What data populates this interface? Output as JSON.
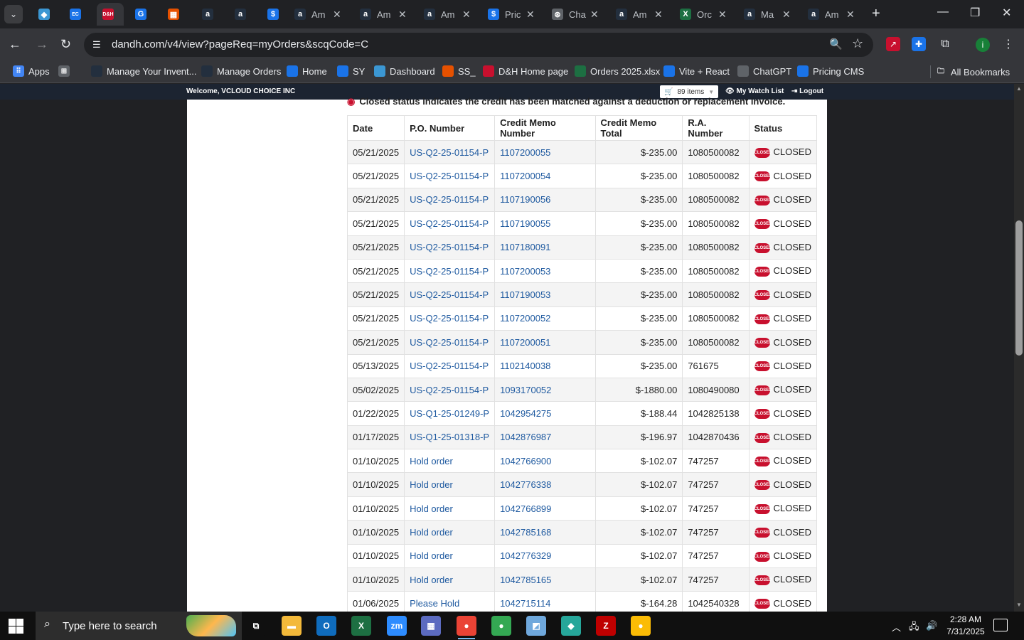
{
  "browser": {
    "tabs": [
      {
        "icon": "diamond-icon",
        "title": "",
        "color": "#3b97d3",
        "glyph": "◆"
      },
      {
        "icon": "ec-icon",
        "title": "",
        "color": "#1a73e8",
        "glyph": "EC"
      },
      {
        "icon": "dh-icon",
        "title": "",
        "color": "#c8102e",
        "glyph": "D&H",
        "active": true
      },
      {
        "icon": "g-icon",
        "title": "",
        "color": "#1a73e8",
        "glyph": "G"
      },
      {
        "icon": "box-icon",
        "title": "",
        "color": "#e65100",
        "glyph": "▦"
      },
      {
        "icon": "amazon-icon",
        "title": "",
        "color": "#232f3e",
        "glyph": "a"
      },
      {
        "icon": "amazon-icon",
        "title": "",
        "color": "#232f3e",
        "glyph": "a"
      },
      {
        "icon": "dollar-icon",
        "title": "",
        "color": "#1a73e8",
        "glyph": "$"
      },
      {
        "icon": "amazon-icon",
        "title": "Am",
        "color": "#232f3e",
        "glyph": "a"
      },
      {
        "icon": "amazon-icon",
        "title": "Am",
        "color": "#232f3e",
        "glyph": "a"
      },
      {
        "icon": "amazon-icon",
        "title": "Am",
        "color": "#232f3e",
        "glyph": "a"
      },
      {
        "icon": "dollar-icon",
        "title": "Pric",
        "color": "#1a73e8",
        "glyph": "$"
      },
      {
        "icon": "chatgpt-icon",
        "title": "Cha",
        "color": "#5f6368",
        "glyph": "⊛"
      },
      {
        "icon": "amazon-icon",
        "title": "Am",
        "color": "#232f3e",
        "glyph": "a"
      },
      {
        "icon": "excel-icon",
        "title": "Orc",
        "color": "#1d6f42",
        "glyph": "X"
      },
      {
        "icon": "amazon-icon",
        "title": "Ma",
        "color": "#232f3e",
        "glyph": "a"
      },
      {
        "icon": "amazon-icon",
        "title": "Am",
        "color": "#232f3e",
        "glyph": "a"
      }
    ],
    "url": "dandh.com/v4/view?pageReq=myOrders&scqCode=C",
    "profile_initial": "i",
    "bookmarks": [
      {
        "label": "Apps",
        "icon": "apps-grid-icon",
        "color": "#4285f4"
      },
      {
        "label": "",
        "icon": "tab-groups-icon",
        "color": "#5f6368"
      },
      {
        "label": "Manage Your Invent...",
        "icon": "amazon-icon",
        "color": "#232f3e"
      },
      {
        "label": "Manage Orders",
        "icon": "amazon-icon",
        "color": "#232f3e"
      },
      {
        "label": "Home",
        "icon": "g-icon",
        "color": "#1a73e8"
      },
      {
        "label": "SY",
        "icon": "ec-icon",
        "color": "#1a73e8"
      },
      {
        "label": "Dashboard",
        "icon": "diamond-icon",
        "color": "#3b97d3"
      },
      {
        "label": "SS_",
        "icon": "box-icon",
        "color": "#e65100"
      },
      {
        "label": "D&H Home page",
        "icon": "dh-icon",
        "color": "#c8102e"
      },
      {
        "label": "Orders 2025.xlsx",
        "icon": "excel-icon",
        "color": "#1d6f42"
      },
      {
        "label": "Vite + React",
        "icon": "dollar-icon",
        "color": "#1a73e8"
      },
      {
        "label": "ChatGPT",
        "icon": "chatgpt-icon",
        "color": "#5f6368"
      },
      {
        "label": "Pricing CMS",
        "icon": "dollar-icon",
        "color": "#1a73e8"
      }
    ],
    "all_bookmarks": "All Bookmarks"
  },
  "site": {
    "welcome": "Welcome, VCLOUD CHOICE INC",
    "cart_items": "89 items",
    "watch_list": "My Watch List",
    "logout": "Logout",
    "note": "Closed status indicates the credit has been matched against a deduction or replacement invoice."
  },
  "table": {
    "headers": [
      "Date",
      "P.O. Number",
      "Credit Memo Number",
      "Credit Memo Total",
      "R.A. Number",
      "Status"
    ],
    "status_badge_text": "CLOSED",
    "rows": [
      {
        "date": "05/21/2025",
        "po": "US-Q2-25-01154-P",
        "memo": "1107200055",
        "total": "$-235.00",
        "ra": "1080500082",
        "status": "CLOSED"
      },
      {
        "date": "05/21/2025",
        "po": "US-Q2-25-01154-P",
        "memo": "1107200054",
        "total": "$-235.00",
        "ra": "1080500082",
        "status": "CLOSED"
      },
      {
        "date": "05/21/2025",
        "po": "US-Q2-25-01154-P",
        "memo": "1107190056",
        "total": "$-235.00",
        "ra": "1080500082",
        "status": "CLOSED"
      },
      {
        "date": "05/21/2025",
        "po": "US-Q2-25-01154-P",
        "memo": "1107190055",
        "total": "$-235.00",
        "ra": "1080500082",
        "status": "CLOSED"
      },
      {
        "date": "05/21/2025",
        "po": "US-Q2-25-01154-P",
        "memo": "1107180091",
        "total": "$-235.00",
        "ra": "1080500082",
        "status": "CLOSED"
      },
      {
        "date": "05/21/2025",
        "po": "US-Q2-25-01154-P",
        "memo": "1107200053",
        "total": "$-235.00",
        "ra": "1080500082",
        "status": "CLOSED"
      },
      {
        "date": "05/21/2025",
        "po": "US-Q2-25-01154-P",
        "memo": "1107190053",
        "total": "$-235.00",
        "ra": "1080500082",
        "status": "CLOSED"
      },
      {
        "date": "05/21/2025",
        "po": "US-Q2-25-01154-P",
        "memo": "1107200052",
        "total": "$-235.00",
        "ra": "1080500082",
        "status": "CLOSED"
      },
      {
        "date": "05/21/2025",
        "po": "US-Q2-25-01154-P",
        "memo": "1107200051",
        "total": "$-235.00",
        "ra": "1080500082",
        "status": "CLOSED"
      },
      {
        "date": "05/13/2025",
        "po": "US-Q2-25-01154-P",
        "memo": "1102140038",
        "total": "$-235.00",
        "ra": "761675",
        "status": "CLOSED"
      },
      {
        "date": "05/02/2025",
        "po": "US-Q2-25-01154-P",
        "memo": "1093170052",
        "total": "$-1880.00",
        "ra": "1080490080",
        "status": "CLOSED"
      },
      {
        "date": "01/22/2025",
        "po": "US-Q1-25-01249-P",
        "memo": "1042954275",
        "total": "$-188.44",
        "ra": "1042825138",
        "status": "CLOSED"
      },
      {
        "date": "01/17/2025",
        "po": "US-Q1-25-01318-P",
        "memo": "1042876987",
        "total": "$-196.97",
        "ra": "1042870436",
        "status": "CLOSED"
      },
      {
        "date": "01/10/2025",
        "po": "Hold order",
        "memo": "1042766900",
        "total": "$-102.07",
        "ra": "747257",
        "status": "CLOSED"
      },
      {
        "date": "01/10/2025",
        "po": "Hold order",
        "memo": "1042776338",
        "total": "$-102.07",
        "ra": "747257",
        "status": "CLOSED"
      },
      {
        "date": "01/10/2025",
        "po": "Hold order",
        "memo": "1042766899",
        "total": "$-102.07",
        "ra": "747257",
        "status": "CLOSED"
      },
      {
        "date": "01/10/2025",
        "po": "Hold order",
        "memo": "1042785168",
        "total": "$-102.07",
        "ra": "747257",
        "status": "CLOSED"
      },
      {
        "date": "01/10/2025",
        "po": "Hold order",
        "memo": "1042776329",
        "total": "$-102.07",
        "ra": "747257",
        "status": "CLOSED"
      },
      {
        "date": "01/10/2025",
        "po": "Hold order",
        "memo": "1042785165",
        "total": "$-102.07",
        "ra": "747257",
        "status": "CLOSED"
      },
      {
        "date": "01/06/2025",
        "po": "Please Hold",
        "memo": "1042715114",
        "total": "$-164.28",
        "ra": "1042540328",
        "status": "CLOSED"
      }
    ]
  },
  "taskbar": {
    "search_placeholder": "Type here to search",
    "apps": [
      {
        "icon": "task-view-icon",
        "glyph": "⧉",
        "color": "#101010"
      },
      {
        "icon": "file-explorer-icon",
        "glyph": "▬",
        "color": "#f3b93a"
      },
      {
        "icon": "outlook-icon",
        "glyph": "O",
        "color": "#0f6cbd"
      },
      {
        "icon": "excel-icon",
        "glyph": "X",
        "color": "#1d6f42"
      },
      {
        "icon": "zoom-icon",
        "glyph": "zm",
        "color": "#2d8cff"
      },
      {
        "icon": "calculator-icon",
        "glyph": "▦",
        "color": "#5c6bc0"
      },
      {
        "icon": "chrome-icon",
        "glyph": "●",
        "color": "#ea4335",
        "active": true
      },
      {
        "icon": "chrome-icon",
        "glyph": "●",
        "color": "#34a853"
      },
      {
        "icon": "notes-icon",
        "glyph": "◩",
        "color": "#6fa8dc"
      },
      {
        "icon": "diamond-app-icon",
        "glyph": "◆",
        "color": "#26a69a"
      },
      {
        "icon": "filezilla-icon",
        "glyph": "Z",
        "color": "#bf0000"
      },
      {
        "icon": "chrome-icon",
        "glyph": "●",
        "color": "#fbbc05"
      }
    ],
    "time": "2:28 AM",
    "date": "7/31/2025"
  }
}
